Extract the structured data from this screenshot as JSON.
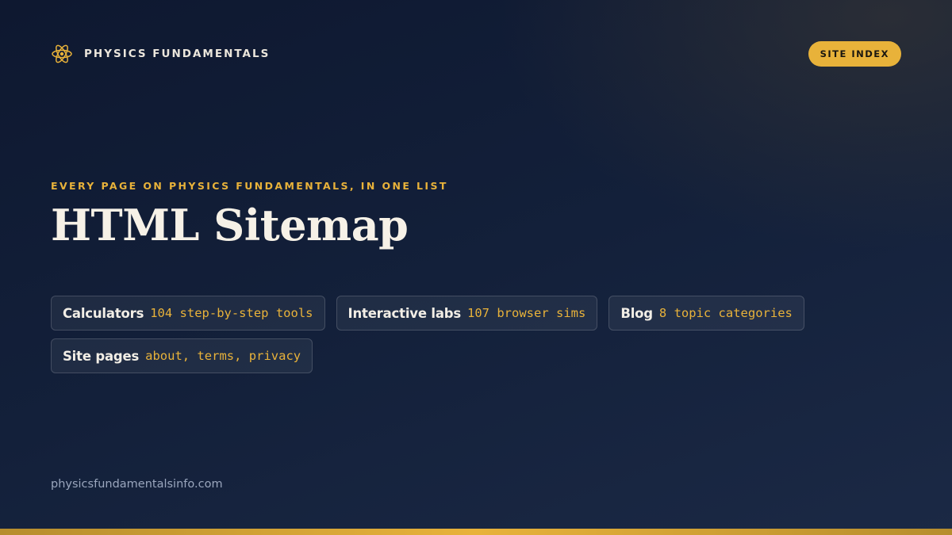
{
  "brand": {
    "logo_icon": "atom-icon",
    "name": "PHYSICS FUNDAMENTALS"
  },
  "badge": {
    "label": "SITE INDEX"
  },
  "hero": {
    "eyebrow": "EVERY PAGE ON PHYSICS FUNDAMENTALS, IN ONE LIST",
    "title": "HTML Sitemap"
  },
  "chips": [
    {
      "label": "Calculators",
      "detail": "104 step-by-step tools"
    },
    {
      "label": "Interactive labs",
      "detail": "107 browser sims"
    },
    {
      "label": "Blog",
      "detail": "8 topic categories"
    },
    {
      "label": "Site pages",
      "detail": "about, terms, privacy"
    }
  ],
  "footer": {
    "url": "physicsfundamentalsinfo.com"
  },
  "colors": {
    "accent": "#e8b23a",
    "background": "#13203a",
    "text": "#f4efe6",
    "muted": "#9aa6bd"
  }
}
